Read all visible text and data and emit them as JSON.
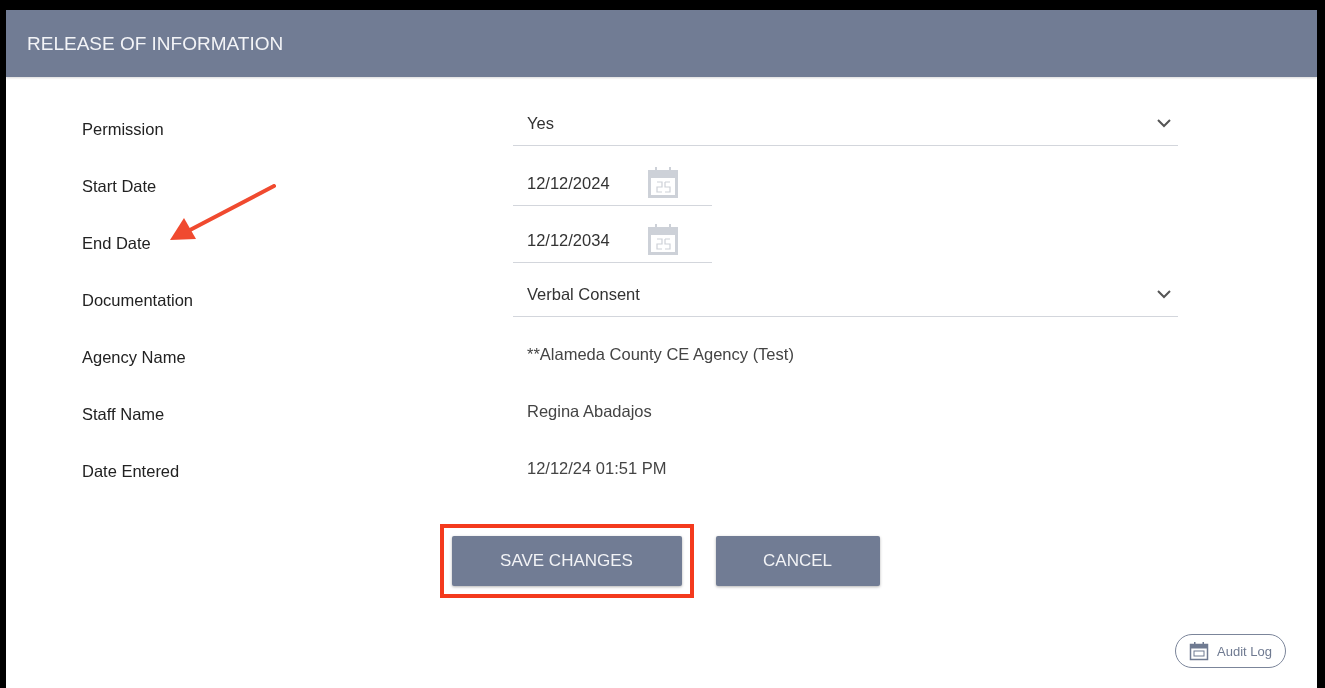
{
  "header": {
    "title": "RELEASE OF INFORMATION"
  },
  "fields": [
    {
      "label": "Permission",
      "kind": "select",
      "value": "Yes",
      "pointed": false
    },
    {
      "label": "Start Date",
      "kind": "date",
      "value": "12/12/2024",
      "pointed": false
    },
    {
      "label": "End Date",
      "kind": "date",
      "value": "12/12/2034",
      "pointed": true
    },
    {
      "label": "Documentation",
      "kind": "select",
      "value": "Verbal Consent",
      "pointed": false
    },
    {
      "label": "Agency Name",
      "kind": "text",
      "value": "**Alameda County CE Agency (Test)",
      "pointed": false
    },
    {
      "label": "Staff Name",
      "kind": "text",
      "value": "Regina Abadajos",
      "pointed": false
    },
    {
      "label": "Date Entered",
      "kind": "text",
      "value": "12/12/24 01:51 PM",
      "pointed": false
    }
  ],
  "buttons": [
    {
      "label": "SAVE CHANGES",
      "highlighted": true
    },
    {
      "label": "CANCEL",
      "highlighted": false
    }
  ],
  "audit_log": {
    "label": "Audit Log"
  }
}
